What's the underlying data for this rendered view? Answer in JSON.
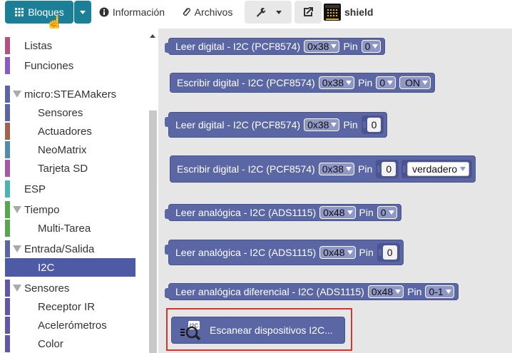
{
  "toolbar": {
    "blocks_label": "Bloques",
    "info_label": "Información",
    "files_label": "Archivos",
    "board_label": "shield",
    "colors": {
      "primary": "#1a7f97",
      "light": "#e8e8e8"
    }
  },
  "sidebar": {
    "items": [
      {
        "label": "Listas",
        "color": "#b5517d",
        "indent": false,
        "expander": false
      },
      {
        "label": "Funciones",
        "color": "#8a5cc0",
        "indent": false,
        "expander": false
      },
      {
        "label": "micro:STEAMakers",
        "color": "#5b67a5",
        "indent": false,
        "expander": true
      },
      {
        "label": "Sensores",
        "color": "#5b67a5",
        "indent": true,
        "expander": false
      },
      {
        "label": "Actuadores",
        "color": "#a0634f",
        "indent": true,
        "expander": false
      },
      {
        "label": "NeoMatrix",
        "color": "#4f8db0",
        "indent": true,
        "expander": false
      },
      {
        "label": "Tarjeta SD",
        "color": "#a55aa8",
        "indent": true,
        "expander": false
      },
      {
        "label": "ESP",
        "color": "#4cb5b0",
        "indent": false,
        "expander": false
      },
      {
        "label": "Tiempo",
        "color": "#56a84f",
        "indent": false,
        "expander": true
      },
      {
        "label": "Multi-Tarea",
        "color": "#56a84f",
        "indent": true,
        "expander": false
      },
      {
        "label": "Entrada/Salida",
        "color": "#5b67a5",
        "indent": false,
        "expander": true
      },
      {
        "label": "I2C",
        "color": "#4e5aa6",
        "indent": true,
        "expander": false,
        "selected": true
      },
      {
        "label": "Sensores",
        "color": "#6057a8",
        "indent": false,
        "expander": true
      },
      {
        "label": "Receptor IR",
        "color": "#6057a8",
        "indent": true,
        "expander": false
      },
      {
        "label": "Acelerómetros",
        "color": "#6057a8",
        "indent": true,
        "expander": false
      },
      {
        "label": "Color",
        "color": "#6057a8",
        "indent": true,
        "expander": false
      }
    ]
  },
  "workspace": {
    "block_color": "#5b67a5",
    "highlight_color": "#d9332e",
    "blocks": [
      {
        "text": "Leer digital - I2C (PCF8574)",
        "addr": "0x38",
        "pin_label": "Pin",
        "pin": "0"
      },
      {
        "text": "Escribir digital - I2C (PCF8574)",
        "addr": "0x38",
        "pin_label": "Pin",
        "pin": "0",
        "state": "ON"
      },
      {
        "text": "Leer digital - I2C (PCF8574)",
        "addr": "0x38",
        "pin_label": "Pin",
        "pin": "0"
      },
      {
        "text": "Escribir digital - I2C (PCF8574)",
        "addr": "0x38",
        "pin_label": "Pin",
        "pin": "0",
        "state": "verdadero"
      },
      {
        "text": "Leer analógica - I2C (ADS1115)",
        "addr": "0x48",
        "pin_label": "Pin",
        "pin": "0"
      },
      {
        "text": "Leer analógica - I2C (ADS1115)",
        "addr": "0x48",
        "pin_label": "Pin",
        "pin": "0"
      },
      {
        "text": "Leer analógica diferencial - I2C (ADS1115)",
        "addr": "0x48",
        "pin_label": "Pin",
        "pin": "0-1"
      },
      {
        "text": "Escanear dispositivos I2C..."
      }
    ]
  }
}
